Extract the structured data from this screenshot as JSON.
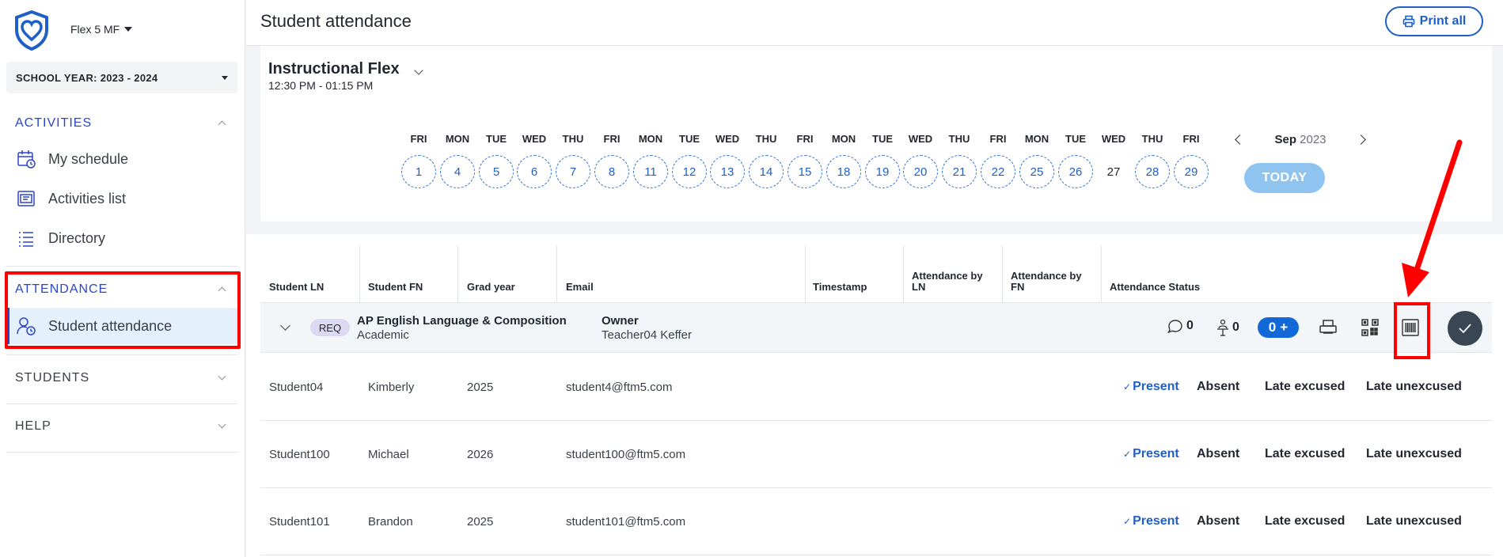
{
  "sidebar": {
    "tenant": "Flex 5 MF",
    "school_year": "SCHOOL YEAR: 2023 - 2024",
    "activities_header": "ACTIVITIES",
    "activities_items": [
      {
        "label": "My schedule",
        "icon": "calendar-clock-icon"
      },
      {
        "label": "Activities list",
        "icon": "activities-list-icon"
      },
      {
        "label": "Directory",
        "icon": "directory-list-icon"
      }
    ],
    "attendance_header": "ATTENDANCE",
    "attendance_items": [
      {
        "label": "Student attendance",
        "icon": "user-clock-icon"
      }
    ],
    "students_header": "STUDENTS",
    "help_header": "HELP"
  },
  "header": {
    "title": "Student attendance",
    "print_all": "Print all"
  },
  "activity": {
    "title": "Instructional Flex",
    "time": "12:30 PM - 01:15 PM",
    "days": [
      {
        "dow": "FRI",
        "date": "1"
      },
      {
        "dow": "MON",
        "date": "4"
      },
      {
        "dow": "TUE",
        "date": "5"
      },
      {
        "dow": "WED",
        "date": "6"
      },
      {
        "dow": "THU",
        "date": "7"
      },
      {
        "dow": "FRI",
        "date": "8"
      },
      {
        "dow": "MON",
        "date": "11"
      },
      {
        "dow": "TUE",
        "date": "12"
      },
      {
        "dow": "WED",
        "date": "13"
      },
      {
        "dow": "THU",
        "date": "14"
      },
      {
        "dow": "FRI",
        "date": "15"
      },
      {
        "dow": "MON",
        "date": "18"
      },
      {
        "dow": "TUE",
        "date": "19"
      },
      {
        "dow": "WED",
        "date": "20"
      },
      {
        "dow": "THU",
        "date": "21"
      },
      {
        "dow": "FRI",
        "date": "22"
      },
      {
        "dow": "MON",
        "date": "25"
      },
      {
        "dow": "TUE",
        "date": "26"
      },
      {
        "dow": "WED",
        "date": "27",
        "selected": true
      },
      {
        "dow": "THU",
        "date": "28"
      },
      {
        "dow": "FRI",
        "date": "29"
      }
    ],
    "month": "Sep",
    "year": "2023",
    "today_label": "TODAY"
  },
  "table": {
    "columns": [
      "Student LN",
      "Student FN",
      "Grad year",
      "Email",
      "Timestamp",
      "Attendance by LN",
      "Attendance by FN",
      "Attendance Status"
    ],
    "group": {
      "tag": "REQ",
      "course": "AP English Language & Composition",
      "course_type": "Academic",
      "owner_label": "Owner",
      "owner_name": "Teacher04 Keffer",
      "comments_count": "0",
      "signatures_count": "0",
      "added_count": "0",
      "add_symbol": "+"
    },
    "status_options": {
      "present": "Present",
      "absent": "Absent",
      "late_excused": "Late excused",
      "late_unexcused": "Late unexcused"
    },
    "rows": [
      {
        "ln": "Student04",
        "fn": "Kimberly",
        "grad": "2025",
        "email": "student4@ftm5.com"
      },
      {
        "ln": "Student100",
        "fn": "Michael",
        "grad": "2026",
        "email": "student100@ftm5.com"
      },
      {
        "ln": "Student101",
        "fn": "Brandon",
        "grad": "2025",
        "email": "student101@ftm5.com"
      }
    ]
  },
  "colors": {
    "accent": "#1f5fc7",
    "nav_active": "#2a46c9",
    "highlight": "#ff0000",
    "today_btn": "#8fc4f1"
  }
}
